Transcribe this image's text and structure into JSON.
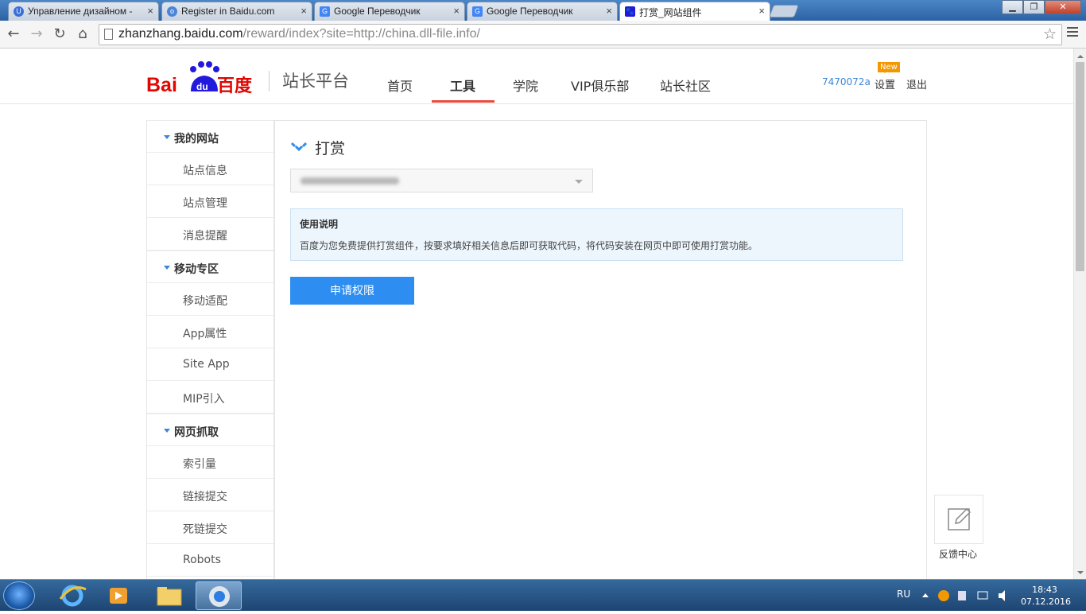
{
  "browser": {
    "tabs": [
      {
        "title": "Управление дизайном - ",
        "icon": "unbounce-icon"
      },
      {
        "title": "Register in Baidu.com",
        "icon": "globe-icon"
      },
      {
        "title": "Google Переводчик",
        "icon": "google-translate-icon"
      },
      {
        "title": "Google Переводчик",
        "icon": "google-translate-icon"
      },
      {
        "title": "打赏_网站组件",
        "icon": "baidu-paw-icon",
        "active": true
      }
    ],
    "url_host": "zhanzhang.baidu.com",
    "url_path": "/reward/index?site=http://china.dll-file.info/"
  },
  "header": {
    "logo_text": "Bai百度",
    "logo_du": "du",
    "platform": "站长平台",
    "nav": [
      "首页",
      "工具",
      "学院",
      "VIP俱乐部",
      "站长社区"
    ],
    "active_nav": "工具",
    "user": "7470072a",
    "settings": "设置",
    "new_badge": "New",
    "logout": "退出"
  },
  "sidebar": {
    "groups": [
      {
        "title": "我的网站",
        "items": [
          "站点信息",
          "站点管理",
          "消息提醒"
        ]
      },
      {
        "title": "移动专区",
        "items": [
          "移动适配",
          "App属性",
          "Site App",
          "MIP引入"
        ]
      },
      {
        "title": "网页抓取",
        "items": [
          "索引量",
          "链接提交",
          "死链提交",
          "Robots"
        ]
      }
    ]
  },
  "main": {
    "title": "打赏",
    "info_title": "使用说明",
    "info_text": "百度为您免费提供打赏组件，按要求填好相关信息后即可获取代码，将代码安装在网页中即可使用打赏功能。",
    "apply_button": "申请权限"
  },
  "feedback": {
    "label": "反馈中心"
  },
  "taskbar": {
    "lang": "RU",
    "time": "18:43",
    "date": "07.12.2016"
  },
  "colors": {
    "accent": "#2d8df0",
    "nav_underline": "#e84c3d",
    "baidu_red": "#e10601",
    "baidu_blue": "#2319dc"
  }
}
